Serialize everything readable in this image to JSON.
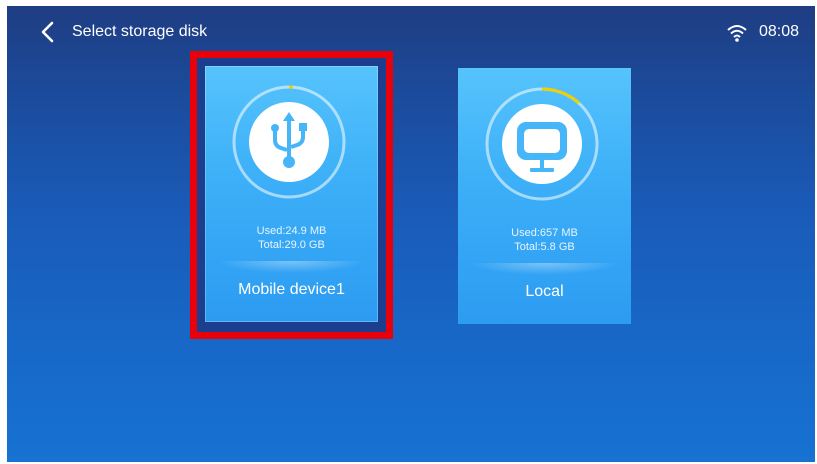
{
  "header": {
    "title": "Select storage disk",
    "time": "08:08",
    "back_icon": "chevron-left-icon",
    "wifi_icon": "wifi-icon"
  },
  "disks": [
    {
      "label": "Mobile device1",
      "used": "Used:24.9 MB",
      "total": "Total:29.0 GB",
      "icon": "usb-icon",
      "usage_fraction": 0.001,
      "selected": true
    },
    {
      "label": "Local",
      "used": "Used:657 MB",
      "total": "Total:5.8 GB",
      "icon": "monitor-icon",
      "usage_fraction": 0.11,
      "selected": false
    }
  ],
  "colors": {
    "selection_frame": "#e8000a",
    "usage_arc": "#f2d000",
    "card_top": "#56c3fc",
    "card_bottom": "#2c9bf2"
  }
}
